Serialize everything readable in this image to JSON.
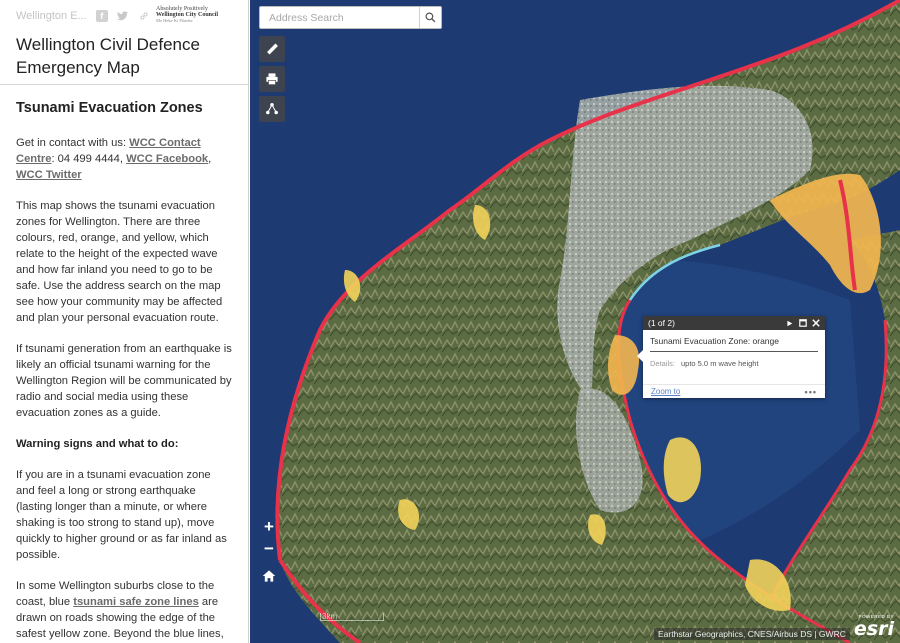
{
  "header": {
    "short_title": "Wellington E...",
    "social_icons": [
      "facebook-icon",
      "twitter-icon",
      "link-icon"
    ],
    "logo": {
      "line1": "Absolutely Positively",
      "line2": "Wellington City Council",
      "line3": "Me Heke Ki Pōneke"
    }
  },
  "app": {
    "title": "Wellington Civil Defence Emergency Map"
  },
  "panel": {
    "heading": "Tsunami Evacuation Zones",
    "contact": {
      "prefix": "Get in contact with us: ",
      "link1": "WCC Contact Centre",
      "mid": ": 04 499 4444, ",
      "link2": "WCC Facebook",
      "sep": ", ",
      "link3": "WCC Twitter"
    },
    "intro": "This map shows the tsunami evacuation zones for Wellington. There are three colours, red, orange, and yellow, which relate to the height of the expected wave and how far inland you need to go to be safe. Use the address search on the map see how your community may be affected and plan your personal evacuation route.",
    "warning_para": "If tsunami generation from an earthquake is likely an official tsunami warning for the Wellington Region will be communicated by radio and social media using these evacuation zones as a guide.",
    "warning_heading": "Warning signs and what to do:",
    "instructions": "If you are in a tsunami evacuation zone and feel a long or strong earthquake (lasting longer than a minute, or where shaking is too strong to stand up), move quickly to higher ground or as far inland as possible.",
    "safe_lines": {
      "prefix": "In some Wellington suburbs close to the coast, blue ",
      "link": "tsunami safe zone lines",
      "suffix": " are drawn on roads showing the edge of the safest yellow zone. Beyond the blue lines, you will be safe."
    }
  },
  "map": {
    "search": {
      "placeholder": "Address Search",
      "value": ""
    },
    "tools": [
      "measure-icon",
      "print-icon",
      "share-icon"
    ],
    "zoom_in": "+",
    "zoom_out": "−",
    "scale": "3km",
    "attribution": "Earthstar Geographics, CNES/Airbus DS | GWRC",
    "esri": {
      "powered": "POWERED BY",
      "word": "esri"
    },
    "colors": {
      "sea": "#1d3a72",
      "land": "#55653d",
      "urban": "#a9aeaa",
      "red_zone": "#e8324a",
      "orange_zone": "#f3b64f",
      "yellow_zone": "#f2d35a",
      "safe_line": "#7fd3e6"
    }
  },
  "popup": {
    "counter": "(1 of 2)",
    "title": "Tsunami Evacuation Zone: orange",
    "field": "Details:",
    "value": "upto 5.0 m wave height",
    "zoom_to": "Zoom to",
    "more": "•••"
  }
}
